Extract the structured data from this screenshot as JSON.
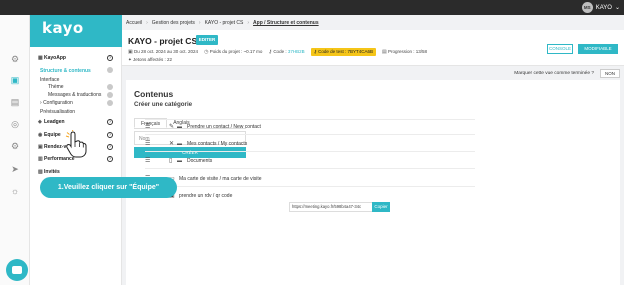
{
  "topbar": {
    "user_initials": "MS",
    "user_name": "KAYO"
  },
  "logo": "kayo",
  "breadcrumb": [
    "Accueil",
    "Gestion des projets",
    "KAYO - projet CS",
    "App / Structure et contenus"
  ],
  "project": {
    "title": "KAYO - projet CS",
    "edit_label": "EDITER",
    "dates": "Du 28 oct. 2024 au 30 oct. 2024",
    "weight": "Poids du projet : ~0.17 mo",
    "code_label": "Code :",
    "code_value": "37HB2B",
    "code_test": "Code de test : 7BYT4CA6B",
    "progress": "Progression : 13/58",
    "tokens": "Jetons affectés : 22",
    "console_label": "CONSOLE",
    "modify_label": "MODIFIABLE"
  },
  "term_question": "Marquer cette vue comme terminée ?",
  "term_value": "NON",
  "sidebar": {
    "kayoapp": "KayoApp",
    "items": [
      {
        "label": "Structure & contenus",
        "active": true
      },
      {
        "label": "Interface"
      },
      {
        "label": "Thème"
      },
      {
        "label": "Messages & traductions"
      },
      {
        "label": "Configuration"
      },
      {
        "label": "Prévisualisation"
      }
    ],
    "sections": [
      "Leadgen",
      "Equipe",
      "Rendez-vous",
      "Performance",
      "Invités"
    ]
  },
  "content": {
    "title": "Contenus",
    "subtitle": "Créer une catégorie",
    "tabs": [
      "Français",
      "Anglais"
    ],
    "name_placeholder": "Nom",
    "create_label": "CRÉER",
    "rows": [
      {
        "label": "Prendre un contact / New contact",
        "icon": "user-plus-icon"
      },
      {
        "label": "Mes contacts / My contacts",
        "icon": "users-icon"
      },
      {
        "label": "Documents",
        "icon": "document-icon"
      },
      {
        "label": "Ma carte de visite / ma carte de visite",
        "icon": "card-icon"
      },
      {
        "label": "prendre un rdv / qr code",
        "icon": "calendar-icon"
      }
    ],
    "url_value": "https://meeting.kayo.fr/598b4a47-34c",
    "copy_label": "Copier"
  },
  "tooltip": "1.Veuillez cliquer sur \"Équipe\"",
  "colors": {
    "accent": "#2fb8c6",
    "topbar": "#2b2b2b",
    "code_test_bg": "#f5c518"
  }
}
